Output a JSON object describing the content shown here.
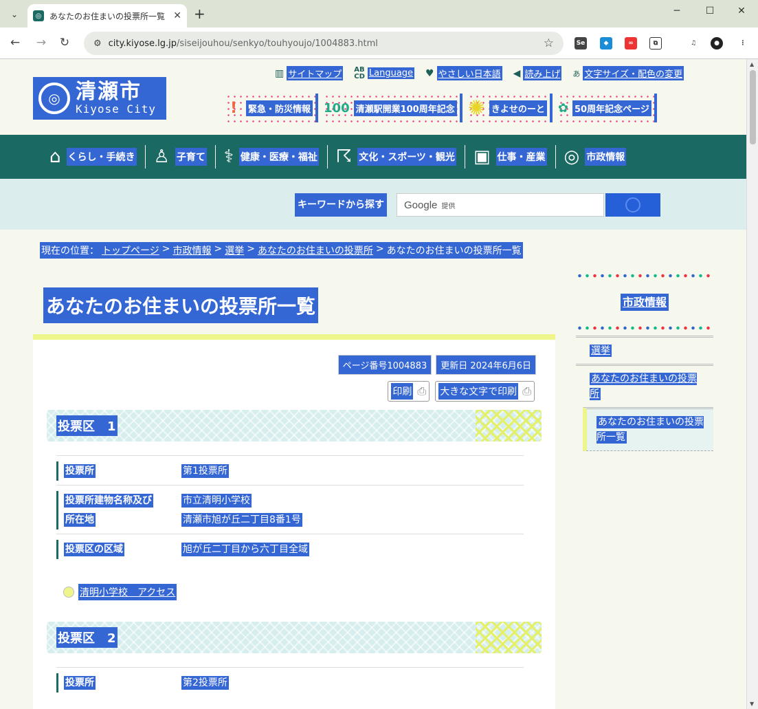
{
  "browser": {
    "tab_title": "あなたのお住まいの投票所一覧｜清",
    "url_domain": "city.kiyose.lg.jp",
    "url_path": "/siseijouhou/senkyo/touhyoujo/1004883.html"
  },
  "header": {
    "logo_jp": "清瀬市",
    "logo_en": "Kiyose City",
    "util_links": [
      {
        "label": "サイトマップ",
        "icon": "map-icon"
      },
      {
        "label": "Language",
        "icon": "language-icon"
      },
      {
        "label": "やさしい日本語",
        "icon": "heart-icon"
      },
      {
        "label": "読み上げ",
        "icon": "speaker-icon"
      },
      {
        "label": "文字サイズ・配色の変更",
        "icon": "font-size-icon"
      }
    ],
    "banners": [
      {
        "label": "緊急・防災情報",
        "icon": "exclamation-icon"
      },
      {
        "label": "清瀬駅開業100周年記念",
        "icon": "anniversary-100-icon"
      },
      {
        "label": "きよせのーと",
        "icon": "sun-icon"
      },
      {
        "label": "50周年記念ページ",
        "icon": "anniversary-50-icon"
      }
    ]
  },
  "gnav": [
    {
      "label": "くらし・手続き",
      "icon": "house-icon"
    },
    {
      "label": "子育て",
      "icon": "child-icon"
    },
    {
      "label": "健康・医療・福祉",
      "icon": "stethoscope-icon"
    },
    {
      "label": "文化・スポーツ・観光",
      "icon": "runner-icon"
    },
    {
      "label": "仕事・産業",
      "icon": "briefcase-icon"
    },
    {
      "label": "市政情報",
      "icon": "city-emblem-icon"
    }
  ],
  "search": {
    "label": "キーワードから探す",
    "provider": "Google",
    "provider_suffix": "提供"
  },
  "breadcrumb": {
    "prefix": "現在の位置：",
    "items": [
      "トップページ",
      "市政情報",
      "選挙",
      "あなたのお住まいの投票所"
    ],
    "sep": ">",
    "current": "あなたのお住まいの投票所一覧"
  },
  "main": {
    "title": "あなたのお住まいの投票所一覧",
    "page_number": "ページ番号1004883",
    "updated": "更新日 2024年6月6日",
    "print_label": "印刷",
    "print_large_label": "大きな文字で印刷",
    "districts": [
      {
        "title": "投票区　1",
        "rows": [
          {
            "key": "投票所",
            "values": [
              "第1投票所"
            ]
          },
          {
            "key_lines": [
              "投票所建物名称及び",
              "所在地"
            ],
            "values": [
              "市立清明小学校",
              "清瀬市旭が丘二丁目8番1号"
            ]
          },
          {
            "key": "投票区の区域",
            "values": [
              "旭が丘二丁目から六丁目全域"
            ]
          }
        ],
        "access": "清明小学校　アクセス"
      },
      {
        "title": "投票区　2",
        "rows": [
          {
            "key": "投票所",
            "values": [
              "第2投票所"
            ]
          }
        ]
      }
    ]
  },
  "side": {
    "title": "市政情報",
    "items": [
      {
        "label": "選挙"
      },
      {
        "label": "あなたのお住まいの投票所"
      },
      {
        "label": "あなたのお住まいの投票所一覧"
      }
    ]
  }
}
